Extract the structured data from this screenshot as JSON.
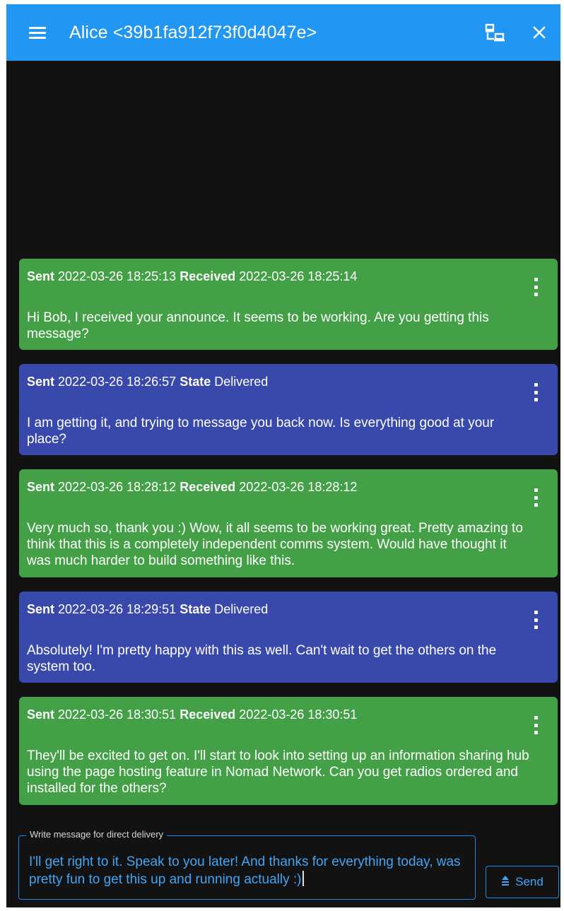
{
  "header": {
    "title": "Alice <39b1fa912f73f0d4047e>",
    "menu_icon": "hamburger-menu-icon",
    "network_icon": "lan-connect-icon",
    "close_icon": "close-icon"
  },
  "colors": {
    "topbar": "#2196f3",
    "background": "#121212",
    "received_bubble": "#43a047",
    "sent_bubble": "#3949ab",
    "accent": "#1e88e5"
  },
  "messages": [
    {
      "direction": "received",
      "sent_label": "Sent",
      "sent_time": "2022-03-26 18:25:13",
      "status_label": "Received",
      "status_value": "2022-03-26 18:25:14",
      "text": "Hi Bob, I received your announce. It seems to be working. Are you getting this message?"
    },
    {
      "direction": "sent",
      "sent_label": "Sent",
      "sent_time": "2022-03-26 18:26:57",
      "status_label": "State",
      "status_value": "Delivered",
      "text": "I am getting it, and trying to message you back now. Is everything good at your place?"
    },
    {
      "direction": "received",
      "sent_label": "Sent",
      "sent_time": "2022-03-26 18:28:12",
      "status_label": "Received",
      "status_value": "2022-03-26 18:28:12",
      "text": "Very much so, thank you :) Wow, it all seems to be working great. Pretty amazing to think that this is a completely independent comms system. Would have thought it was much harder to build something like this."
    },
    {
      "direction": "sent",
      "sent_label": "Sent",
      "sent_time": "2022-03-26 18:29:51",
      "status_label": "State",
      "status_value": "Delivered",
      "text": "Absolutely! I'm pretty happy with this as well. Can't wait to get the others on the system too."
    },
    {
      "direction": "received",
      "sent_label": "Sent",
      "sent_time": "2022-03-26 18:30:51",
      "status_label": "Received",
      "status_value": "2022-03-26 18:30:51",
      "text": "They'll be excited to get on. I'll start to look into setting up an information sharing hub using the page hosting feature in Nomad Network. Can you get radios ordered and installed for the others?"
    }
  ],
  "composer": {
    "label": "Write message for direct delivery",
    "value": "I'll get right to it. Speak to you later! And thanks for everything today, was pretty fun to get this up and running actually :)"
  },
  "send_button": {
    "label": "Send",
    "icon": "send-up-arrow-icon"
  }
}
